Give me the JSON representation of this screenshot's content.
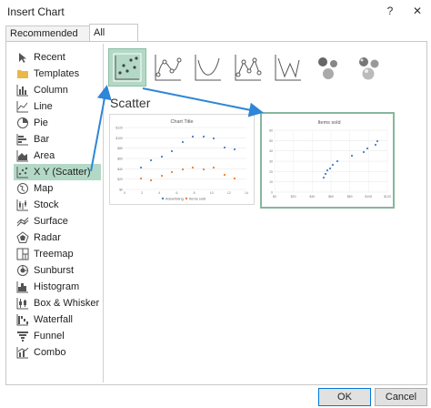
{
  "window": {
    "title": "Insert Chart",
    "help_label": "?",
    "close_label": "✕"
  },
  "tabs": [
    {
      "label": "Recommended Charts",
      "active": false
    },
    {
      "label": "All Charts",
      "active": true
    }
  ],
  "sidebar": {
    "items": [
      {
        "label": "Recent",
        "icon": "recent-icon"
      },
      {
        "label": "Templates",
        "icon": "folder-icon"
      },
      {
        "label": "Column",
        "icon": "column-chart-icon"
      },
      {
        "label": "Line",
        "icon": "line-chart-icon"
      },
      {
        "label": "Pie",
        "icon": "pie-chart-icon"
      },
      {
        "label": "Bar",
        "icon": "bar-chart-icon"
      },
      {
        "label": "Area",
        "icon": "area-chart-icon"
      },
      {
        "label": "X Y (Scatter)",
        "icon": "scatter-chart-icon",
        "selected": true
      },
      {
        "label": "Map",
        "icon": "map-icon"
      },
      {
        "label": "Stock",
        "icon": "stock-chart-icon"
      },
      {
        "label": "Surface",
        "icon": "surface-chart-icon"
      },
      {
        "label": "Radar",
        "icon": "radar-chart-icon"
      },
      {
        "label": "Treemap",
        "icon": "treemap-icon"
      },
      {
        "label": "Sunburst",
        "icon": "sunburst-icon"
      },
      {
        "label": "Histogram",
        "icon": "histogram-icon"
      },
      {
        "label": "Box & Whisker",
        "icon": "box-whisker-icon"
      },
      {
        "label": "Waterfall",
        "icon": "waterfall-icon"
      },
      {
        "label": "Funnel",
        "icon": "funnel-icon"
      },
      {
        "label": "Combo",
        "icon": "combo-chart-icon"
      }
    ]
  },
  "section": {
    "title": "Scatter"
  },
  "subtypes": [
    {
      "name": "scatter",
      "selected": true
    },
    {
      "name": "scatter-smooth-lines-markers"
    },
    {
      "name": "scatter-smooth-lines"
    },
    {
      "name": "scatter-straight-lines-markers"
    },
    {
      "name": "scatter-straight-lines"
    },
    {
      "name": "bubble"
    },
    {
      "name": "3d-bubble"
    }
  ],
  "previews": {
    "left": {
      "title": "Chart Title",
      "y_ticks": [
        "$120",
        "$100",
        "$80",
        "$60",
        "$40",
        "$20",
        "$0"
      ],
      "x_ticks": [
        "0",
        "2",
        "4",
        "6",
        "8",
        "10",
        "12",
        "14"
      ],
      "legend": [
        "Advertising",
        "Items sold"
      ],
      "colors": {
        "series1": "#4a7fc1",
        "series2": "#ed7d31"
      }
    },
    "right": {
      "title": "Items sold",
      "y_ticks": [
        "60",
        "50",
        "40",
        "30",
        "20",
        "10",
        "0"
      ],
      "x_ticks": [
        "$0",
        "$20",
        "$40",
        "$60",
        "$80",
        "$100",
        "$120"
      ]
    }
  },
  "footer": {
    "ok_label": "OK",
    "cancel_label": "Cancel"
  },
  "accent": {
    "selection": "#b3d9c6",
    "arrow": "#2e86d6"
  }
}
